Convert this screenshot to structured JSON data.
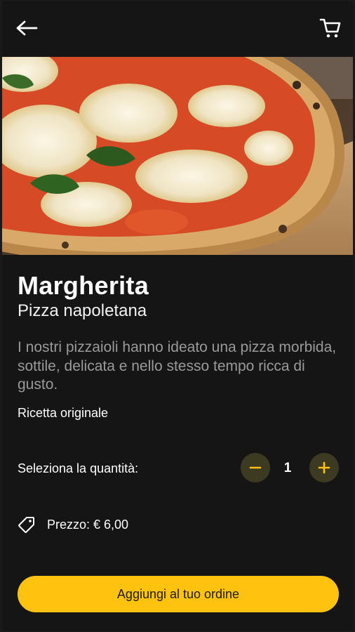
{
  "colors": {
    "background": "#151515",
    "accent": "#ffc20e",
    "stepper_bg": "#3d3a22",
    "muted_text": "#9a9a9a"
  },
  "header": {
    "back_icon": "arrow-left-icon",
    "cart_icon": "shopping-cart-icon"
  },
  "product": {
    "name": "Margherita",
    "category": "Pizza napoletana",
    "description": "I nostri pizzaioli hanno ideato una pizza morbida, sottile, delicata e nello stesso tempo ricca di gusto.",
    "recipe_label": "Ricetta originale"
  },
  "quantity": {
    "label": "Seleziona la quantità:",
    "value": "1",
    "minus_symbol": "−",
    "plus_symbol": "+"
  },
  "price": {
    "icon": "price-tag-icon",
    "text": "Prezzo: € 6,00"
  },
  "actions": {
    "add_to_order": "Aggiungi al tuo ordine"
  }
}
